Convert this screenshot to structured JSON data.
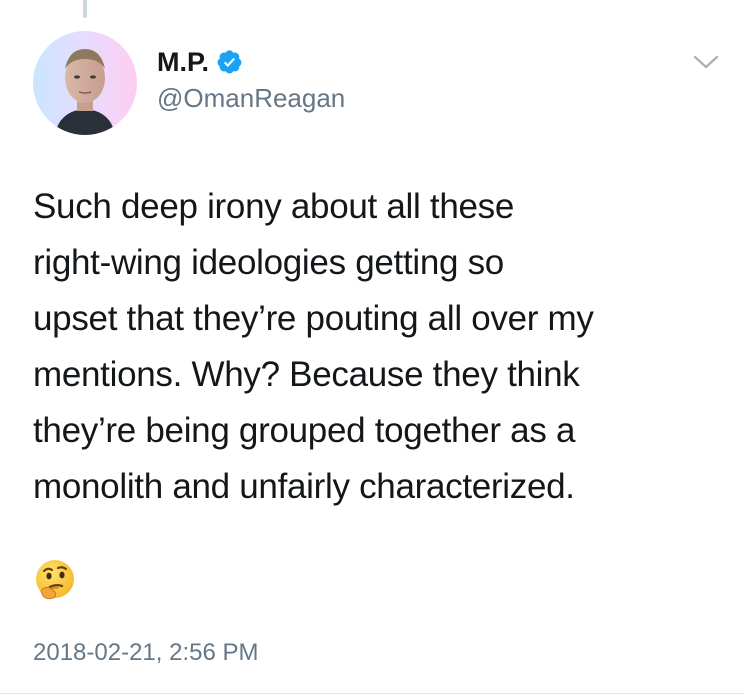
{
  "tweet": {
    "author_name": "M.P.",
    "handle": "@OmanReagan",
    "verified": true,
    "text": "Such deep irony about all these\nright-wing ideologies getting so\nupset that they’re pouting all over my\nmentions. Why? Because they think\nthey’re being grouped together as a\nmonolith and unfairly characterized.",
    "emoji": "thinking-face",
    "timestamp": "2018-02-21, 2:56 PM"
  },
  "icons": {
    "verified": "verified-badge-icon",
    "menu": "chevron-down-icon",
    "emoji": "thinking-face-icon"
  },
  "colors": {
    "text_primary": "#14171a",
    "text_secondary": "#657786",
    "verified_blue": "#1da1f2",
    "divider": "#e1e8ed",
    "thread_line": "#ccd6dd"
  }
}
